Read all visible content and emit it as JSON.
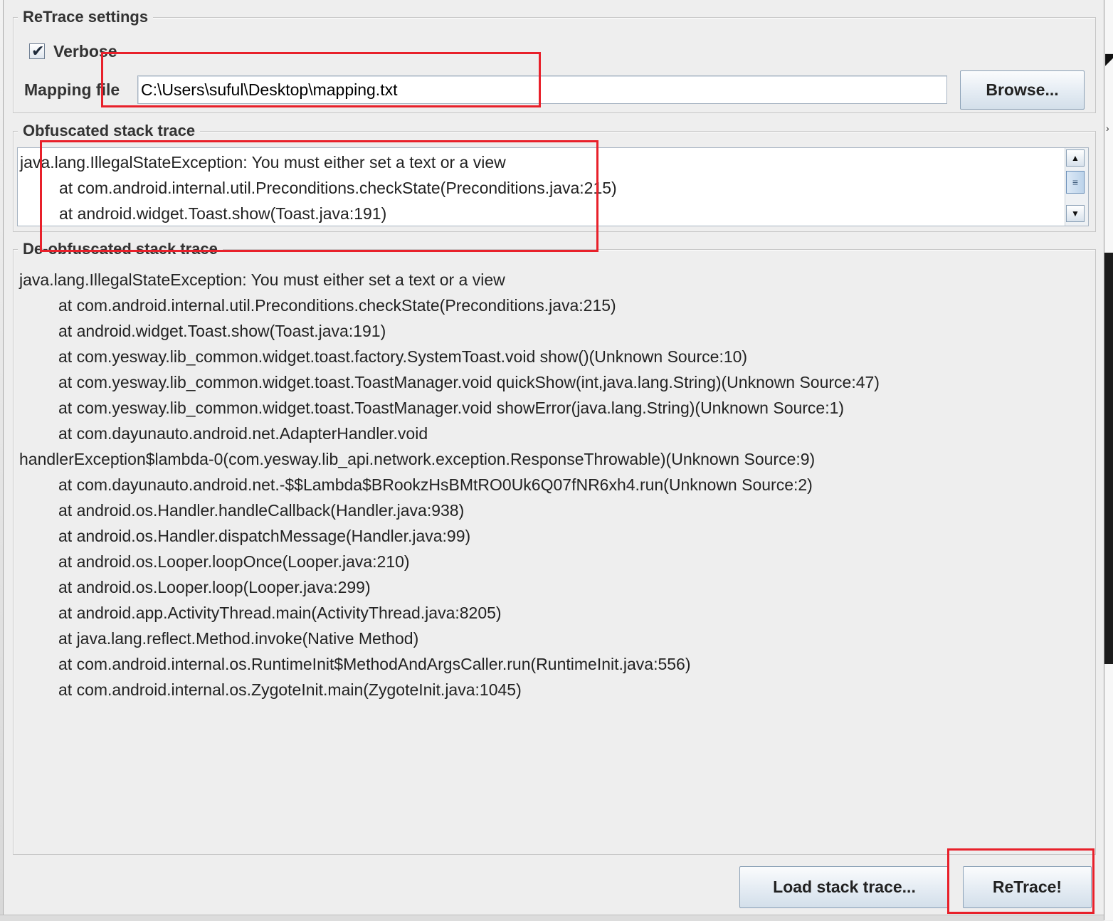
{
  "retrace_settings": {
    "legend": "ReTrace settings",
    "verbose_label": "Verbose",
    "verbose_checked": true,
    "mapping_label": "Mapping file",
    "mapping_value": "C:\\Users\\suful\\Desktop\\mapping.txt",
    "browse_label": "Browse..."
  },
  "obfuscated": {
    "legend": "Obfuscated stack trace",
    "lines": [
      "java.lang.IllegalStateException: You must either set a text or a view",
      "\tat com.android.internal.util.Preconditions.checkState(Preconditions.java:215)",
      "\tat android.widget.Toast.show(Toast.java:191)"
    ]
  },
  "deobfuscated": {
    "legend": "De-obfuscated stack trace",
    "lines": [
      "java.lang.IllegalStateException: You must either set a text or a view",
      "\tat com.android.internal.util.Preconditions.checkState(Preconditions.java:215)",
      "\tat android.widget.Toast.show(Toast.java:191)",
      "\tat com.yesway.lib_common.widget.toast.factory.SystemToast.void show()(Unknown Source:10)",
      "\tat com.yesway.lib_common.widget.toast.ToastManager.void quickShow(int,java.lang.String)(Unknown Source:47)",
      "\tat com.yesway.lib_common.widget.toast.ToastManager.void showError(java.lang.String)(Unknown Source:1)",
      "\tat com.dayunauto.android.net.AdapterHandler.void",
      "handlerException$lambda-0(com.yesway.lib_api.network.exception.ResponseThrowable)(Unknown Source:9)",
      "\tat com.dayunauto.android.net.-$$Lambda$BRookzHsBMtRO0Uk6Q07fNR6xh4.run(Unknown Source:2)",
      "\tat android.os.Handler.handleCallback(Handler.java:938)",
      "\tat android.os.Handler.dispatchMessage(Handler.java:99)",
      "\tat android.os.Looper.loopOnce(Looper.java:210)",
      "\tat android.os.Looper.loop(Looper.java:299)",
      "\tat android.app.ActivityThread.main(ActivityThread.java:8205)",
      "\tat java.lang.reflect.Method.invoke(Native Method)",
      "\tat com.android.internal.os.RuntimeInit$MethodAndArgsCaller.run(RuntimeInit.java:556)",
      "\tat com.android.internal.os.ZygoteInit.main(ZygoteInit.java:1045)"
    ]
  },
  "buttons": {
    "load_label": "Load stack trace...",
    "retrace_label": "ReTrace!"
  },
  "icons": {
    "checkmark": "checkmark-icon",
    "scroll_up": "arrow-up-icon",
    "scroll_down": "arrow-down-icon",
    "thumb_grip": "grip-icon"
  },
  "colors": {
    "highlight": "#e8202a",
    "background": "#eeeeee"
  }
}
